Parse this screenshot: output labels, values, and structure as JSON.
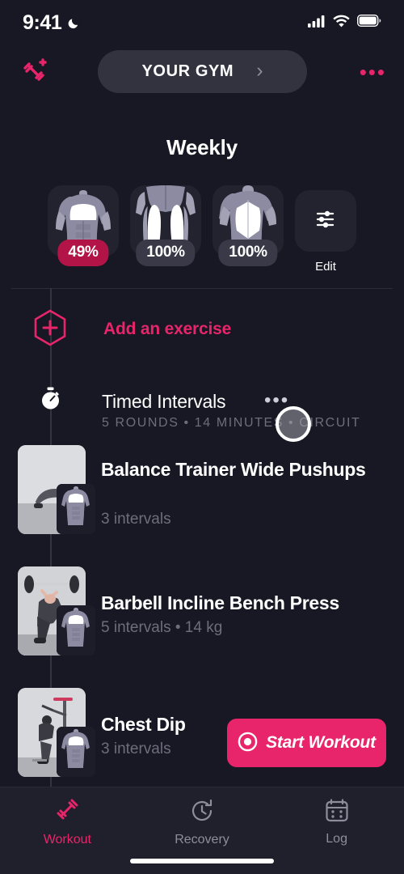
{
  "status_bar": {
    "time": "9:41",
    "moon_icon": "crescent-moon-icon",
    "cellular_icon": "cellular-signal-icon",
    "wifi_icon": "wifi-icon",
    "battery_icon": "battery-full-icon"
  },
  "top_bar": {
    "add_workout_icon": "dumbbell-plus-icon",
    "gym_label": "YOUR GYM",
    "gym_chevron": "›",
    "overflow_menu": "•••"
  },
  "weekly": {
    "title": "Weekly",
    "cards": [
      {
        "name": "chest-front-muscle-card",
        "percent": "49%",
        "active": true
      },
      {
        "name": "legs-muscle-card",
        "percent": "100%",
        "active": false
      },
      {
        "name": "back-muscle-card",
        "percent": "100%",
        "active": false
      }
    ],
    "edit": {
      "label": "Edit",
      "icon": "sliders-icon"
    }
  },
  "add_exercise": {
    "label": "Add an exercise",
    "icon": "hexagon-plus-icon"
  },
  "timed_intervals": {
    "icon": "stopwatch-icon",
    "title": "Timed Intervals",
    "menu": "•••",
    "subtitle": "5 ROUNDS • 14 MINUTES • CIRCUIT"
  },
  "exercises": [
    {
      "name": "balance-trainer-wide-pushups",
      "title": "Balance Trainer Wide Pushups",
      "detail": "3 intervals",
      "thumbnail": "pushup-photo",
      "muscle_badge": "chest-muscle-badge"
    },
    {
      "name": "barbell-incline-bench-press",
      "title": "Barbell Incline Bench Press",
      "detail": "5 intervals • 14 kg",
      "thumbnail": "bench-press-photo",
      "muscle_badge": "chest-muscle-badge"
    },
    {
      "name": "chest-dip",
      "title": "Chest Dip",
      "detail": "3 intervals",
      "thumbnail": "chest-dip-photo",
      "muscle_badge": "chest-muscle-badge"
    }
  ],
  "start_workout": {
    "label": "Start Workout",
    "icon": "record-circle-icon"
  },
  "tab_bar": {
    "tabs": [
      {
        "name": "tab-workout",
        "label": "Workout",
        "icon": "dumbbell-icon",
        "active": true
      },
      {
        "name": "tab-recovery",
        "label": "Recovery",
        "icon": "clock-rotate-icon",
        "active": false
      },
      {
        "name": "tab-log",
        "label": "Log",
        "icon": "calendar-icon",
        "active": false
      }
    ]
  },
  "cursor": {
    "name": "cursor-ring"
  },
  "colors": {
    "background": "#181724",
    "accent": "#e8256a",
    "badge_active": "#b31447",
    "card": "#23222f",
    "muted_text": "#6e6d7c"
  }
}
